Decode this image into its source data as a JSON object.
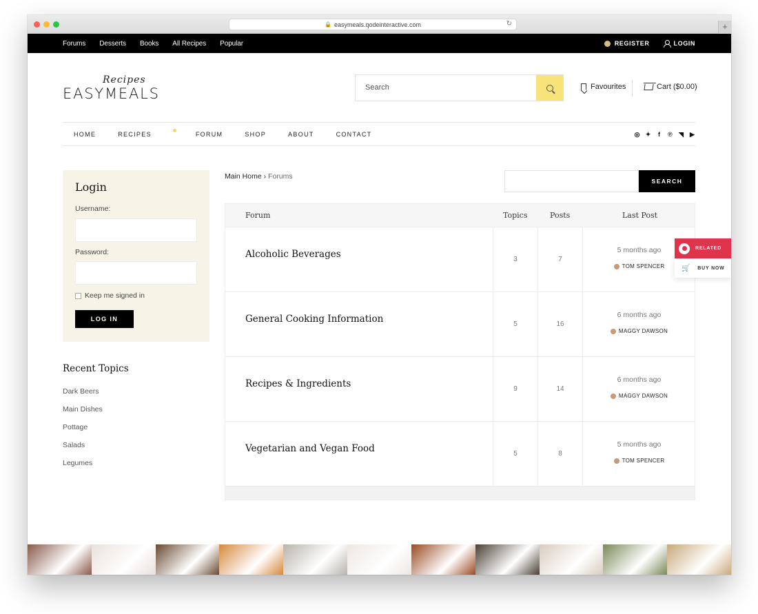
{
  "browser": {
    "url": "easymeals.qodeinteractive.com",
    "newtab": "+",
    "reload": "↻"
  },
  "topbar": {
    "links": [
      "Forums",
      "Desserts",
      "Books",
      "All Recipes",
      "Popular"
    ],
    "register": "REGISTER",
    "login": "LOGIN"
  },
  "header": {
    "logo_script": "Recipes",
    "logo_word": "EASYMEALS",
    "search_placeholder": "Search",
    "favourites": "Favourites",
    "cart": "Cart ($0.00)"
  },
  "nav": {
    "items": [
      "HOME",
      "RECIPES",
      "FORUM",
      "SHOP",
      "ABOUT",
      "CONTACT"
    ],
    "social": [
      "instagram-icon",
      "twitter-icon",
      "facebook-icon",
      "pinterest-icon",
      "rss-icon",
      "youtube-icon"
    ]
  },
  "login": {
    "title": "Login",
    "username_label": "Username:",
    "password_label": "Password:",
    "keep_signed": "Keep me signed in",
    "button": "LOG IN"
  },
  "recent": {
    "title": "Recent Topics",
    "items": [
      "Dark Beers",
      "Main Dishes",
      "Pottage",
      "Salads",
      "Legumes"
    ]
  },
  "breadcrumb": {
    "home": "Main Home",
    "sep": "›",
    "current": "Forums"
  },
  "forum_search": {
    "button": "SEARCH"
  },
  "table": {
    "headers": {
      "forum": "Forum",
      "topics": "Topics",
      "posts": "Posts",
      "last": "Last Post"
    },
    "rows": [
      {
        "title": "Alcoholic Beverages",
        "topics": "3",
        "posts": "7",
        "ago": "5 months ago",
        "author": "TOM SPENCER"
      },
      {
        "title": "General Cooking Information",
        "topics": "5",
        "posts": "16",
        "ago": "6 months ago",
        "author": "MAGGY DAWSON"
      },
      {
        "title": "Recipes & Ingredients",
        "topics": "9",
        "posts": "14",
        "ago": "6 months ago",
        "author": "MAGGY DAWSON"
      },
      {
        "title": "Vegetarian and Vegan Food",
        "topics": "5",
        "posts": "8",
        "ago": "5 months ago",
        "author": "TOM SPENCER"
      }
    ]
  },
  "widget": {
    "related": "RELATED",
    "buy": "BUY NOW"
  },
  "colors": {
    "accent_yellow": "#f8e27a",
    "related_red": "#e0344c",
    "login_bg": "#f7f4e7"
  },
  "strip_colors": [
    "#8a5a4a",
    "#e9e1dc",
    "#6b4a32",
    "#d7893a",
    "#b8b4ac",
    "#ede7e2",
    "#9a4a22",
    "#4a4036",
    "#d9cdbf",
    "#7a8a5a",
    "#c9a97a"
  ]
}
